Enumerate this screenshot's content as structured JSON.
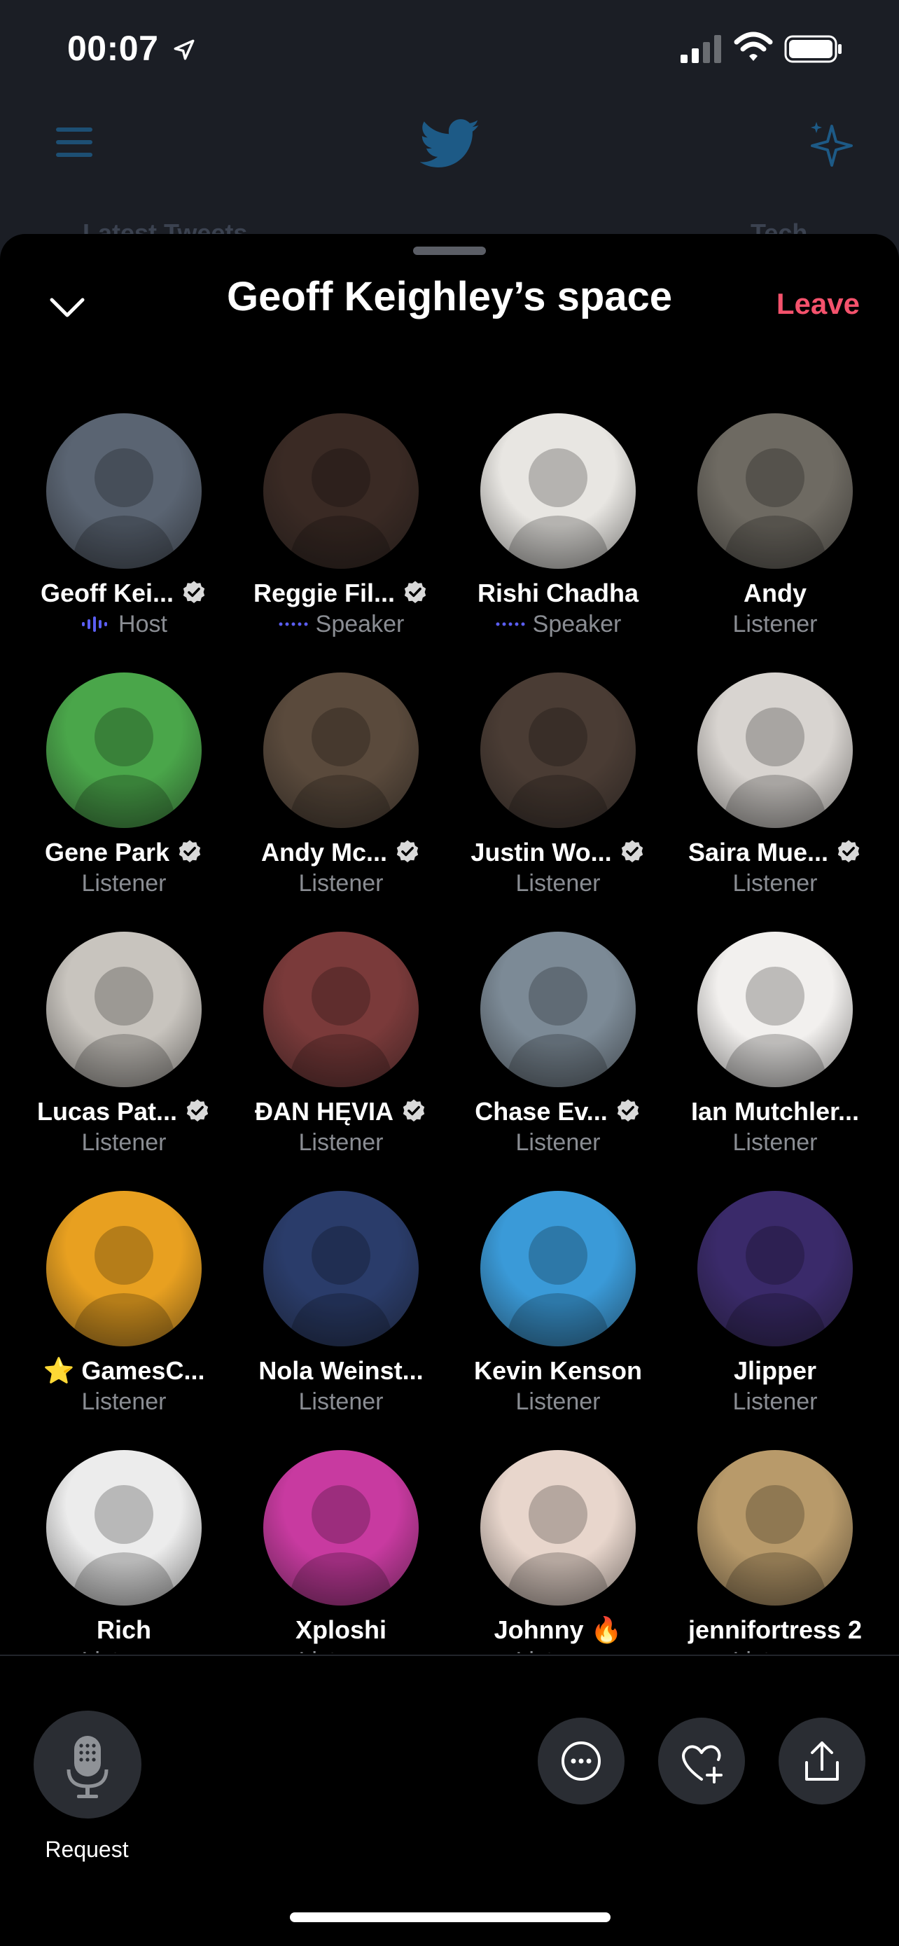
{
  "status_bar": {
    "time": "00:07"
  },
  "background": {
    "tab_left": "Latest Tweets",
    "tab_right": "Tech"
  },
  "space": {
    "title": "Geoff Keighley’s space",
    "leave_label": "Leave"
  },
  "participants": [
    {
      "name": "Geoff Kei...",
      "role": "Host",
      "verified": true,
      "color": "#5a6472"
    },
    {
      "name": "Reggie Fil...",
      "role": "Speaker",
      "verified": true,
      "color": "#3a2a24"
    },
    {
      "name": "Rishi Chadha",
      "role": "Speaker",
      "verified": false,
      "color": "#e8e6e2"
    },
    {
      "name": "Andy",
      "role": "Listener",
      "verified": false,
      "color": "#6e6a62"
    },
    {
      "name": "Gene Park",
      "role": "Listener",
      "verified": true,
      "color": "#4aa64a"
    },
    {
      "name": "Andy Mc...",
      "role": "Listener",
      "verified": true,
      "color": "#5a4a3c"
    },
    {
      "name": "Justin Wo...",
      "role": "Listener",
      "verified": true,
      "color": "#4a3c34"
    },
    {
      "name": "Saira Mue...",
      "role": "Listener",
      "verified": true,
      "color": "#d8d4d0"
    },
    {
      "name": "Lucas Pat...",
      "role": "Listener",
      "verified": true,
      "color": "#c8c4be"
    },
    {
      "name": "ĐAN HĘVIA",
      "role": "Listener",
      "verified": true,
      "color": "#7a3a3a"
    },
    {
      "name": "Chase Ev...",
      "role": "Listener",
      "verified": true,
      "color": "#7c8a96"
    },
    {
      "name": "Ian Mutchler...",
      "role": "Listener",
      "verified": false,
      "color": "#f2f0ee"
    },
    {
      "name": "⭐ GamesC...",
      "role": "Listener",
      "verified": false,
      "color": "#e8a020"
    },
    {
      "name": "Nola Weinst...",
      "role": "Listener",
      "verified": false,
      "color": "#2a3c6a"
    },
    {
      "name": "Kevin Kenson",
      "role": "Listener",
      "verified": false,
      "color": "#3a9ad8"
    },
    {
      "name": "Jlipper",
      "role": "Listener",
      "verified": false,
      "color": "#3a2a6a"
    },
    {
      "name": "Rich",
      "role": "Listener",
      "verified": false,
      "color": "#ececec"
    },
    {
      "name": "Xploshi",
      "role": "Listener",
      "verified": false,
      "color": "#c83aa0"
    },
    {
      "name": "Johnny 🔥",
      "role": "Listener",
      "verified": false,
      "color": "#e8d6cc"
    },
    {
      "name": "jennifortress 2",
      "role": "Listener",
      "verified": false,
      "color": "#b89a6a"
    }
  ],
  "bottom_bar": {
    "request_label": "Request"
  },
  "colors": {
    "accent_leave": "#f4526c",
    "host_indicator": "#5b5ef2",
    "muted_text": "#8a8d93",
    "button_bg": "#2a2d33"
  },
  "icons": [
    "location-arrow-icon",
    "signal-icon",
    "wifi-icon",
    "battery-icon",
    "menu-icon",
    "twitter-bird-icon",
    "sparkle-icon",
    "chevron-down-icon",
    "verified-badge-icon",
    "microphone-icon",
    "more-icon",
    "heart-plus-icon",
    "share-icon"
  ]
}
